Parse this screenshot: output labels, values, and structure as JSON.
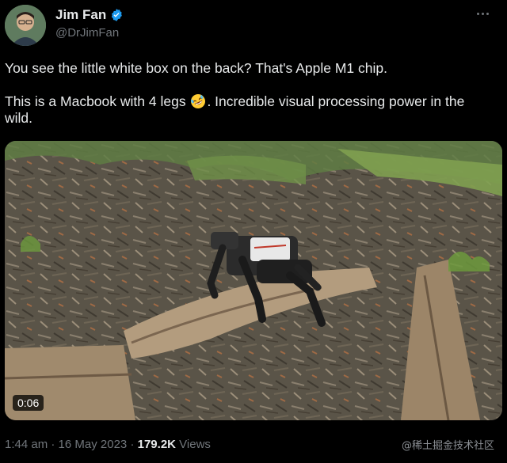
{
  "author": {
    "display_name": "Jim Fan",
    "handle": "@DrJimFan",
    "verified": true,
    "verified_color": "#1d9bf0"
  },
  "tweet": {
    "line1": "You see the little white box on the back? That's Apple M1 chip.",
    "line2_before_emoji": "This is a Macbook with 4 legs ",
    "emoji": "rolling-on-floor-laughing",
    "line2_after_emoji": ". Incredible visual processing power in the wild."
  },
  "media": {
    "type": "video",
    "duration": "0:06"
  },
  "footer": {
    "time": "1:44 am",
    "separator": "·",
    "date": "16 May 2023",
    "views_count": "179.2K",
    "views_label": "Views"
  },
  "watermark": "@稀土掘金技术社区",
  "colors": {
    "background": "#000000",
    "primary_text": "#e7e9ea",
    "secondary_text": "#71767b",
    "accent": "#1d9bf0"
  }
}
